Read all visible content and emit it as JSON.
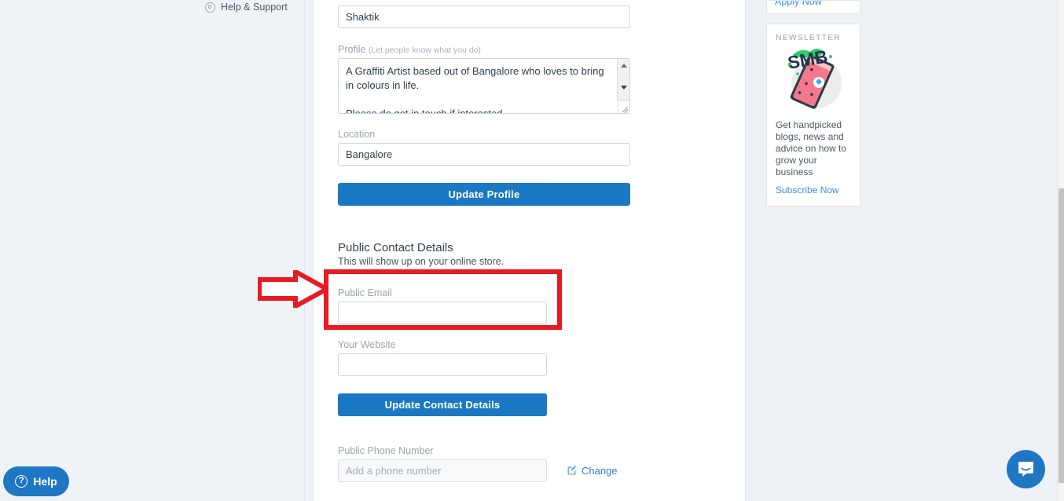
{
  "colors": {
    "accent_blue": "#1b79c3",
    "link_blue": "#3f8fdd",
    "annotation_red": "#e81b23",
    "page_bg": "#eef2f6",
    "panel_bg": "#ffffff"
  },
  "sidebar": {
    "help_support_label": "Help & Support",
    "help_support_icon": "lifebuoy-icon"
  },
  "profile_form": {
    "name_value": "Shaktik",
    "name_placeholder": "",
    "profile_label": "Profile",
    "profile_hint": "(Let people know what you do)",
    "profile_value": "A Graffiti Artist based out of Bangalore who loves to bring in colours in life.\n\nPlease do get in touch if interested.",
    "location_label": "Location",
    "location_value": "Bangalore",
    "update_profile_label": "Update Profile"
  },
  "contact_section": {
    "title": "Public Contact Details",
    "subtitle": "This will show up on your online store.",
    "public_email_label": "Public Email",
    "public_email_value": "",
    "public_email_placeholder": "",
    "website_label": "Your Website",
    "website_value": "",
    "website_placeholder": "",
    "update_contact_label": "Update Contact Details",
    "phone_label": "Public Phone Number",
    "phone_value": "",
    "phone_placeholder": "Add a phone number",
    "change_label": "Change",
    "change_icon": "edit-pencil-icon"
  },
  "right_column": {
    "apply_now_label": "Apply Now",
    "newsletter": {
      "kicker": "NEWSLETTER",
      "art_icon": "smb-watermelon-illustration",
      "body": "Get handpicked blogs, news and advice on how to grow your business",
      "subscribe_label": "Subscribe Now"
    }
  },
  "widgets": {
    "help_button_label": "Help",
    "help_button_icon": "question-circle-icon",
    "messenger_icon": "messenger-chat-icon"
  },
  "annotation": {
    "arrow_icon": "red-arrow-right-icon",
    "highlight_target": "Public Email"
  }
}
